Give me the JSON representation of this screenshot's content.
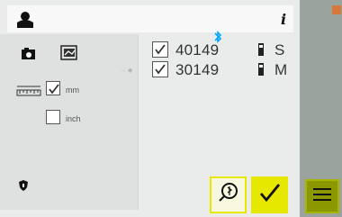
{
  "header": {
    "user_icon": "user-icon",
    "info_icon": "info-icon"
  },
  "toolbar": {
    "camera_icon": "camera-icon",
    "gallery_icon": "gallery-icon"
  },
  "units": {
    "ruler_icon": "ruler-icon",
    "options": [
      {
        "label": "mm",
        "checked": true
      },
      {
        "label": "inch",
        "checked": false
      }
    ]
  },
  "devices": [
    {
      "id": "40149",
      "checked": true,
      "size": "S"
    },
    {
      "id": "30149",
      "checked": true,
      "size": "M"
    }
  ],
  "colors": {
    "accent": "#e7e800",
    "menu": "#8b9800",
    "bluetooth": "#00a6ff"
  },
  "footer": {
    "shield_icon": "shield-icon",
    "search_icon": "search-icon",
    "check_icon": "check-icon",
    "menu_icon": "menu-icon"
  }
}
